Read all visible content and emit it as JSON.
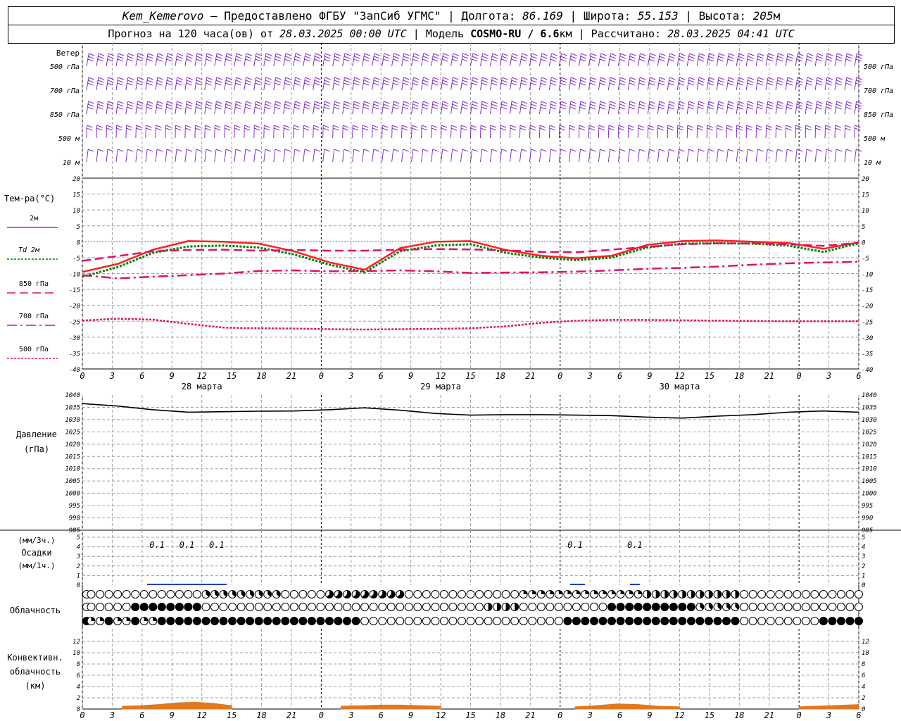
{
  "header": {
    "line1": {
      "station": "Kem_Kemerovo",
      "provider": " — Предоставлено ФГБУ \"ЗапСиб УГМС\" | Долгота: ",
      "lon": "86.169",
      "lat_label": " | Широта: ",
      "lat": "55.153",
      "alt_label": " | Высота: ",
      "alt": "205",
      "alt_unit": "м"
    },
    "line2": {
      "forecast_label": "Прогноз на 120 часа(ов) от ",
      "run": "28.03.2025 00:00 UTC",
      "model_label": " | Модель ",
      "model": "COSMO-RU / 6.6",
      "model_unit": "км",
      "calc_label": " | Рассчитано: ",
      "calc": "28.03.2025 04:41 UTC"
    }
  },
  "chart_data": [
    {
      "type": "wind_barbs",
      "title": "Ветер",
      "levels": [
        "500 гПа",
        "700 гПа",
        "850 гПа",
        "500 м",
        "10 м"
      ],
      "x_hours": [
        0,
        60
      ],
      "note": "wind barbs every ~1.5 h at each level"
    },
    {
      "type": "line",
      "title": "Тем-ра(°C)",
      "ylim": [
        -40,
        20
      ],
      "yticks": [
        20,
        15,
        10,
        5,
        0,
        -5,
        -10,
        -15,
        -20,
        -25,
        -30,
        -35,
        -40
      ],
      "x_hours": [
        0,
        3,
        6,
        9,
        12,
        15,
        18,
        21,
        24,
        27,
        30,
        33,
        36,
        39,
        42,
        45,
        48,
        51,
        54,
        57,
        60
      ],
      "series": [
        {
          "name": "2м",
          "color": "#ff2020",
          "style": "solid",
          "values": [
            -9.5,
            -7.0,
            -2.5,
            0.2,
            0.0,
            -0.6,
            -3.0,
            -6.5,
            -8.8,
            -2.0,
            0.0,
            0.2,
            -2.6,
            -4.4,
            -5.2,
            -4.4,
            -1.0,
            0.2,
            0.4,
            0.0,
            -0.4,
            -2.2,
            -0.2
          ]
        },
        {
          "name": "Td 2м",
          "color": "#008000",
          "style": "dotted",
          "values": [
            -11.0,
            -8.0,
            -3.5,
            -1.5,
            -1.2,
            -1.8,
            -4.0,
            -7.2,
            -9.6,
            -3.0,
            -1.2,
            -0.8,
            -3.5,
            -5.0,
            -5.8,
            -5.0,
            -1.8,
            -0.6,
            -0.5,
            -0.6,
            -1.2,
            -3.2,
            -0.5
          ]
        },
        {
          "name": "850 гПа",
          "color": "#e0106a",
          "style": "dashed",
          "values": [
            -6.0,
            -4.5,
            -3.0,
            -2.6,
            -2.5,
            -2.8,
            -2.6,
            -2.8,
            -2.8,
            -2.5,
            -2.3,
            -2.4,
            -2.7,
            -3.2,
            -3.3,
            -2.5,
            -1.6,
            -0.8,
            -0.5,
            -0.5,
            -0.8,
            -1.3,
            -0.3
          ]
        },
        {
          "name": "700 гПа",
          "color": "#e0106a",
          "style": "dashdot",
          "values": [
            -10.5,
            -11.5,
            -11.0,
            -10.5,
            -10.0,
            -9.2,
            -9.0,
            -9.3,
            -9.2,
            -9.0,
            -9.3,
            -9.8,
            -9.7,
            -9.6,
            -9.4,
            -9.0,
            -8.5,
            -8.2,
            -7.8,
            -7.2,
            -6.8,
            -6.5,
            -6.3
          ]
        },
        {
          "name": "500 гПа",
          "color": "#e0106a",
          "style": "dotted",
          "values": [
            -24.8,
            -24.2,
            -24.5,
            -25.8,
            -27.0,
            -27.2,
            -27.3,
            -27.5,
            -27.6,
            -27.5,
            -27.4,
            -27.2,
            -26.6,
            -25.5,
            -24.8,
            -24.6,
            -24.6,
            -24.7,
            -24.8,
            -24.9,
            -25.0,
            -25.0,
            -25.0
          ]
        }
      ],
      "xlabels_days": [
        "28 марта",
        "29 марта",
        "30 марта"
      ]
    },
    {
      "type": "line",
      "title": "Давление",
      "ylabel": "(гПа)",
      "ylim": [
        985,
        1040
      ],
      "yticks": [
        1040,
        1035,
        1030,
        1025,
        1020,
        1015,
        1010,
        1005,
        1000,
        995,
        990,
        985
      ],
      "x_hours": [
        0,
        3,
        6,
        9,
        12,
        15,
        18,
        21,
        24,
        27,
        30,
        33,
        36,
        39,
        42,
        45,
        48,
        51,
        54,
        57,
        60
      ],
      "series": [
        {
          "name": "",
          "color": "#000000",
          "values": [
            1036.5,
            1035.5,
            1034.0,
            1033.0,
            1033.2,
            1033.4,
            1033.5,
            1034.0,
            1034.8,
            1033.8,
            1032.5,
            1031.8,
            1032.0,
            1032.0,
            1031.8,
            1031.6,
            1031.0,
            1030.6,
            1031.4,
            1032.0,
            1033.0,
            1033.5,
            1033.0
          ]
        }
      ]
    },
    {
      "type": "bar",
      "title": "Осадки",
      "ylabel_top": "(мм/3ч.)",
      "ylabel_bottom": "(мм/1ч.)",
      "ylim": [
        0,
        5
      ],
      "yticks": [
        5,
        4,
        3,
        2,
        1,
        0
      ],
      "labels": [
        {
          "hour": 7.5,
          "value": "0.1"
        },
        {
          "hour": 10.5,
          "value": "0.1"
        },
        {
          "hour": 13.5,
          "value": "0.1"
        },
        {
          "hour": 49.5,
          "value": "0.1"
        },
        {
          "hour": 55.5,
          "value": "0.1"
        }
      ]
    },
    {
      "type": "symbols",
      "title": "Облачность",
      "rows": 3,
      "legend": "circle fill = cloud cover fraction in eighths (0..8)"
    },
    {
      "type": "area",
      "title": "Конвективн. облачность (км)",
      "ylim": [
        0,
        13
      ],
      "yticks": [
        12,
        10,
        8,
        6,
        4,
        2,
        0
      ],
      "color": "#e07820",
      "segments": [
        {
          "from": 4.0,
          "to": 15.0,
          "values": [
            0.5,
            0.6,
            0.8,
            1.1,
            1.2,
            1.0,
            0.6
          ]
        },
        {
          "from": 26.0,
          "to": 36.0,
          "values": [
            0.5,
            0.6,
            0.7,
            0.7,
            0.6,
            0.5
          ]
        },
        {
          "from": 49.5,
          "to": 60.0,
          "values": [
            0.4,
            0.6,
            0.9,
            0.8,
            0.5,
            0.4
          ]
        },
        {
          "from": 72.0,
          "to": 78.0,
          "values": [
            0.4,
            0.6,
            0.8
          ]
        }
      ]
    }
  ],
  "panels": {
    "wind": {
      "label": "Ветер",
      "levels": [
        "500 гПа",
        "700 гПа",
        "850 гПа",
        "500 м",
        "10 м"
      ]
    },
    "temp": {
      "label": "Тем-ра(°C)",
      "legend": [
        "2м",
        "Td  2м",
        "850 гПа",
        "700 гПа",
        "500 гПа"
      ]
    },
    "pressure": {
      "label1": "Давление",
      "label2": "(гПа)"
    },
    "precip": {
      "label1": "(мм/3ч.)",
      "label2": "Осадки",
      "label3": "(мм/1ч.)"
    },
    "cloud": {
      "label": "Облачность"
    },
    "conv": {
      "label1": "Конвективн.",
      "label2": "облачность",
      "label3": "(км)"
    }
  },
  "xaxis": {
    "ticks": [
      "0",
      "3",
      "6",
      "9",
      "12",
      "15",
      "18",
      "21",
      "0",
      "3",
      "6",
      "9",
      "12",
      "15",
      "18",
      "21",
      "0",
      "3",
      "6",
      "9",
      "12",
      "15",
      "18",
      "21",
      "0",
      "3",
      "6"
    ],
    "days": [
      "28 марта",
      "29 марта",
      "30 марта"
    ]
  },
  "colors": {
    "wind": "#8030d0",
    "grid": "#a0a0a0",
    "t2m": "#ff2020",
    "td": "#008000",
    "upper": "#e0106a",
    "precip": "#2040c0",
    "conv": "#e07820"
  }
}
